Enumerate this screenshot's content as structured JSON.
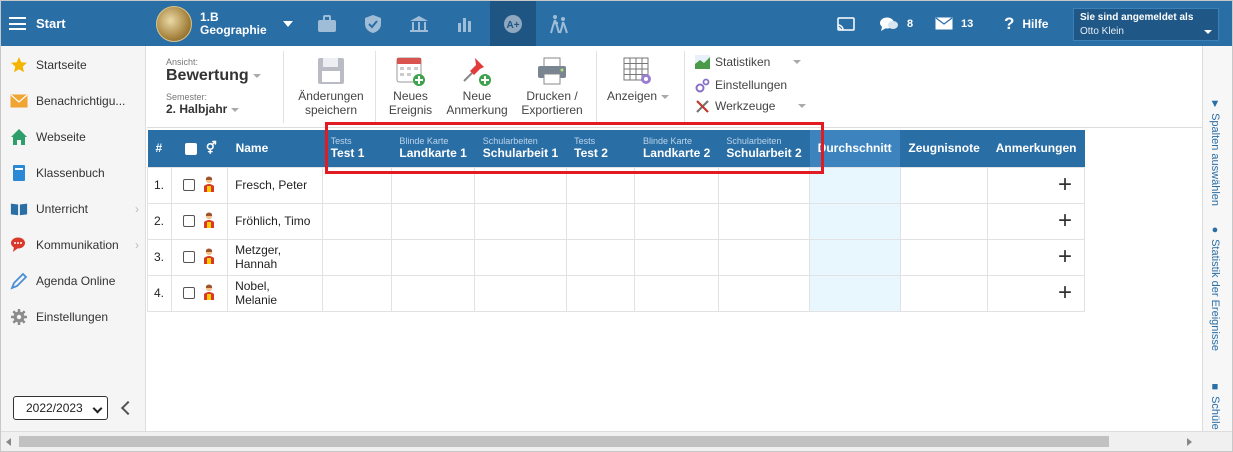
{
  "topbar": {
    "start_label": "Start",
    "class_name": "1.B",
    "subject": "Geographie",
    "messages_count": "8",
    "mail_count": "13",
    "help_label": "Hilfe",
    "login_label": "Sie sind angemeldet als",
    "user_name": "Otto Klein",
    "colors": {
      "bar": "#2a6ea6",
      "active": "#1e5583"
    }
  },
  "sidebar": {
    "items": [
      {
        "label": "Startseite",
        "icon": "star-icon"
      },
      {
        "label": "Benachrichtigu...",
        "icon": "envelope-icon"
      },
      {
        "label": "Webseite",
        "icon": "house-icon"
      },
      {
        "label": "Klassenbuch",
        "icon": "book-icon"
      },
      {
        "label": "Unterricht",
        "icon": "open-book-icon"
      },
      {
        "label": "Kommunikation",
        "icon": "chat-icon"
      },
      {
        "label": "Agenda Online",
        "icon": "pen-icon"
      },
      {
        "label": "Einstellungen",
        "icon": "gear-icon"
      }
    ],
    "school_year": "2022/2023"
  },
  "toolbar": {
    "view_label": "Ansicht:",
    "view_value": "Bewertung",
    "semester_label": "Semester:",
    "semester_value": "2. Halbjahr",
    "save_line1": "Änderungen",
    "save_line2": "speichern",
    "new_event_line1": "Neues",
    "new_event_line2": "Ereignis",
    "new_note_line1": "Neue",
    "new_note_line2": "Anmerkung",
    "print_line1": "Drucken /",
    "print_line2": "Exportieren",
    "show_label": "Anzeigen",
    "stats_label": "Statistiken",
    "settings_label": "Einstellungen",
    "tools_label": "Werkzeuge"
  },
  "right_rail": {
    "tab1": "Spalten auswählen",
    "tab2": "Statistik der Ereignisse",
    "tab3": "Schüle"
  },
  "grid": {
    "hash": "#",
    "name_header": "Name",
    "columns": [
      {
        "category": "Tests",
        "name": "Test 1"
      },
      {
        "category": "Blinde Karte",
        "name": "Landkarte 1"
      },
      {
        "category": "Schularbeiten",
        "name": "Schularbeit 1"
      },
      {
        "category": "Tests",
        "name": "Test 2"
      },
      {
        "category": "Blinde Karte",
        "name": "Landkarte 2"
      },
      {
        "category": "Schularbeiten",
        "name": "Schularbeit 2"
      }
    ],
    "avg_header": "Durchschnitt",
    "grade_header": "Zeugnisnote",
    "notes_header": "Anmerkungen",
    "rows": [
      {
        "num": "1.",
        "name": "Fresch, Peter"
      },
      {
        "num": "2.",
        "name": "Fröhlich, Timo"
      },
      {
        "num": "3.",
        "name": "Metzger, Hannah"
      },
      {
        "num": "4.",
        "name": "Nobel, Melanie"
      }
    ],
    "highlight_color": "#e21b23"
  }
}
